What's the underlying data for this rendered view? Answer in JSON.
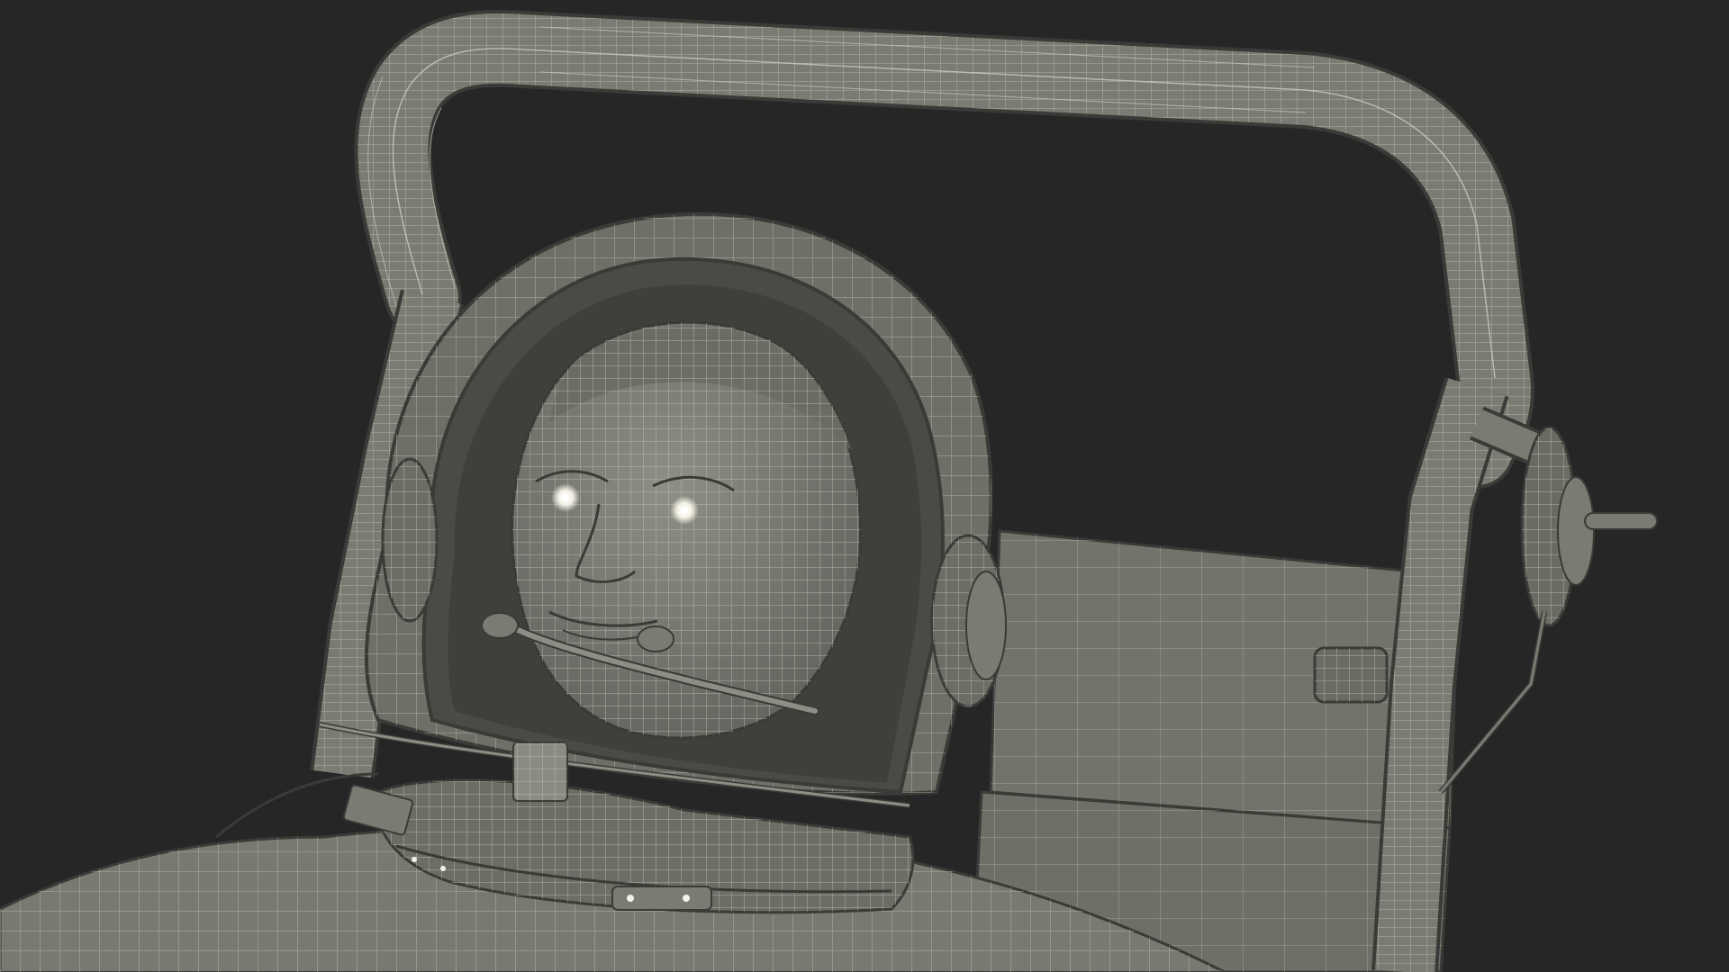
{
  "scene": {
    "subject": "wireframe-render-astronaut-in-seat",
    "render_mode": "wireframe-on-shaded",
    "colors": {
      "background": "#262626",
      "surface": "#7a7b72",
      "surface_dark": "#5f605a",
      "surface_light": "#8d8e85",
      "wire": "#c9cabd",
      "edge": "#3a3b37",
      "eye_highlight": "#f4f2e6"
    },
    "icons": []
  }
}
